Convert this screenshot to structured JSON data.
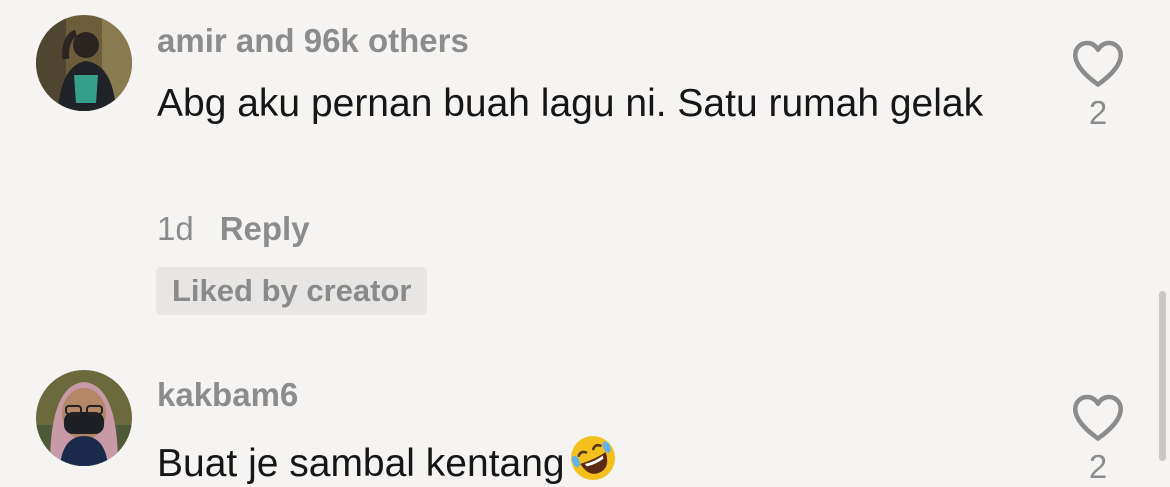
{
  "comments": [
    {
      "username": "amir and 96k others",
      "text": "Abg aku pernan buah lagu ni. Satu rumah gelak",
      "time": "1d",
      "reply_label": "Reply",
      "badge": "Liked by creator",
      "likes": "2"
    },
    {
      "username": "kakbam6",
      "text": "Buat je sambal kentang",
      "emoji": "rolling-on-floor-laughing-emoji",
      "likes": "2"
    }
  ],
  "colors": {
    "background": "#f5f4f2",
    "text": "#161616",
    "muted": "#8c8c8c",
    "badge_bg": "#e7e6e4",
    "emoji": "#f4c01e"
  }
}
